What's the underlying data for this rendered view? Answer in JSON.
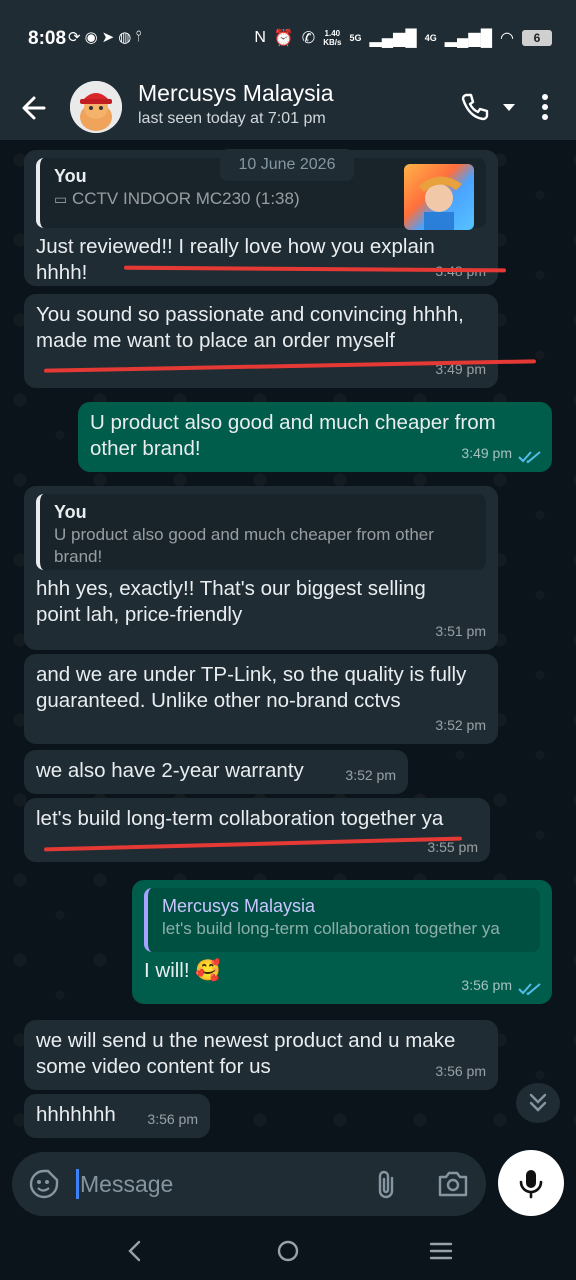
{
  "status_bar": {
    "time": "8:08",
    "left_icons": [
      "sync-icon",
      "messenger-icon",
      "telegram-icon",
      "app-icon",
      "usb-icon"
    ],
    "speed": "1.40",
    "speed_unit": "KB/s",
    "net1": "5G",
    "net2": "4G",
    "battery": "6"
  },
  "header": {
    "contact_name": "Mercusys Malaysia",
    "last_seen": "last seen today at 7:01 pm"
  },
  "date_chip": "10 June 2026",
  "messages": [
    {
      "direction": "in",
      "quote_author": "You",
      "quote_text": "CCTV INDOOR MC230 (1:38)",
      "text": "Just reviewed!! I really love how you explain hhhh!",
      "time": "3:48 pm"
    },
    {
      "direction": "in",
      "text": "You sound so passionate and convincing hhhh, made me want to place an order myself",
      "time": "3:49 pm"
    },
    {
      "direction": "out",
      "text": "U product also good and much cheaper from other brand!",
      "time": "3:49 pm"
    },
    {
      "direction": "in",
      "quote_author": "You",
      "quote_text": "U product also good and much cheaper from other brand!",
      "text": "hhh yes, exactly!! That's our biggest selling point lah, price-friendly",
      "time": "3:51 pm"
    },
    {
      "direction": "in",
      "text": "and we are under TP-Link, so the quality is fully guaranteed. Unlike other no-brand cctvs",
      "time": "3:52 pm"
    },
    {
      "direction": "in",
      "text": "we also have 2-year warranty",
      "time": "3:52 pm"
    },
    {
      "direction": "in",
      "text": "let's build long-term collaboration together ya",
      "time": "3:55 pm"
    },
    {
      "direction": "out",
      "quote_author": "Mercusys Malaysia",
      "quote_text": "let's build long-term collaboration together ya",
      "text": "I will! 🥰",
      "time": "3:56 pm"
    },
    {
      "direction": "in",
      "text": "we will send u the newest product and u make some video content for us",
      "time": "3:56 pm"
    },
    {
      "direction": "in",
      "text": "hhhhhhh",
      "time": "3:56 pm"
    }
  ],
  "composer": {
    "placeholder": "Message"
  },
  "colors": {
    "incoming_bubble": "#1f2c34",
    "outgoing_bubble": "#005c4b",
    "read_ticks": "#53bdeb",
    "highlight_red": "#e53935"
  }
}
